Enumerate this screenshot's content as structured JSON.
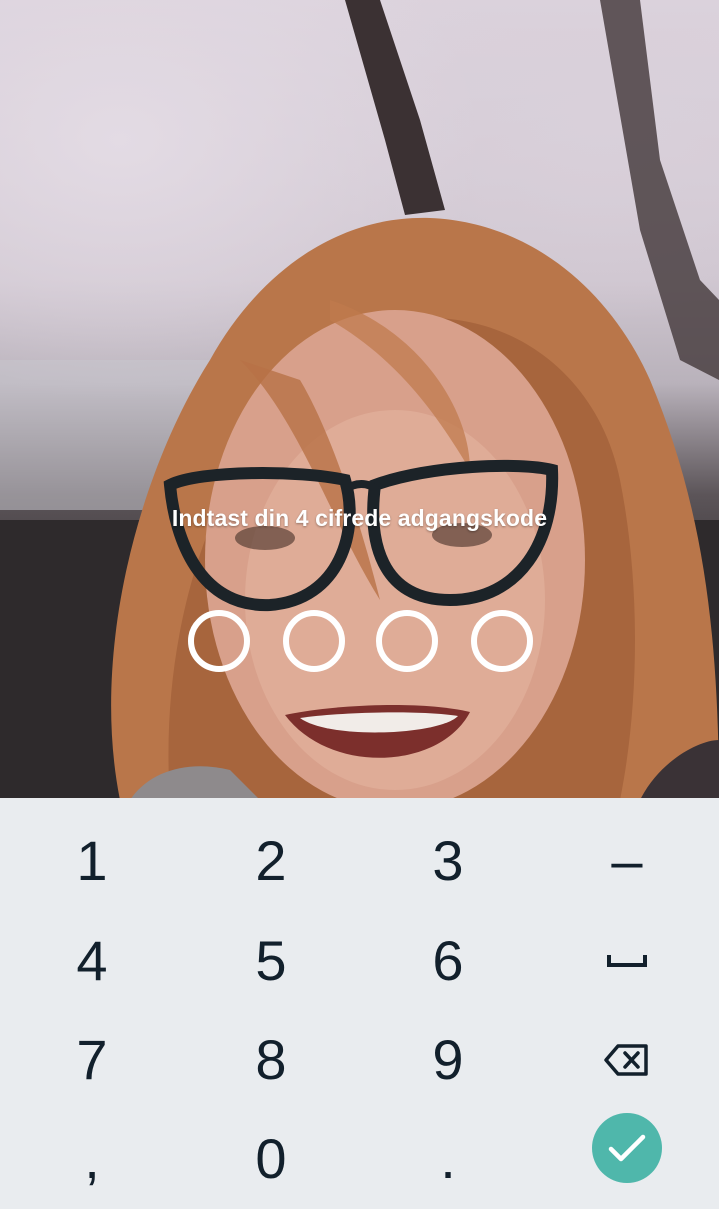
{
  "lock_screen": {
    "prompt": "Indtast din 4 cifrede adgangskode",
    "pin_length": 4,
    "pin_entered": 0
  },
  "keypad": {
    "keys": {
      "k1": "1",
      "k2": "2",
      "k3": "3",
      "minus": "–",
      "k4": "4",
      "k5": "5",
      "k6": "6",
      "space_icon": "space-bar-icon",
      "k7": "7",
      "k8": "8",
      "k9": "9",
      "backspace_icon": "backspace-icon",
      "comma": ",",
      "k0": "0",
      "period": ".",
      "enter_icon": "checkmark-icon"
    },
    "colors": {
      "background": "#e9ecef",
      "key_text": "#12202c",
      "enter_button": "#4fb7ab"
    }
  }
}
